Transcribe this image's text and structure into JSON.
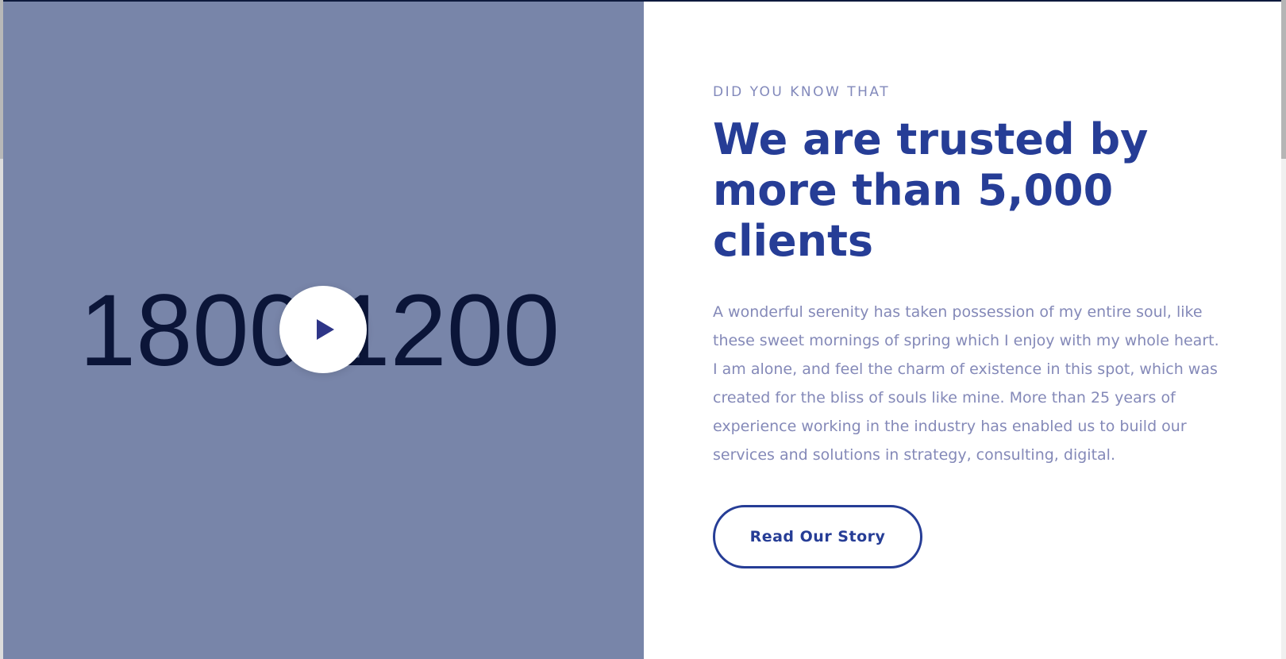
{
  "media": {
    "phone_number": "1800 1200",
    "play_icon": "play-icon"
  },
  "content": {
    "eyebrow": "DID YOU KNOW THAT",
    "headline": "We are trusted by more than 5,000 clients",
    "body": "A wonderful serenity has taken possession of my entire soul, like these sweet mornings of spring which I enjoy with my whole heart. I am alone, and feel the charm of existence in this spot, which was created for the bliss of souls like mine. More than 25 years of experience working in the industry has enabled us to build our services and solutions in strategy, consulting, digital.",
    "cta_label": "Read Our Story"
  },
  "colors": {
    "panel_bg": "#7885a9",
    "number_color": "#0b1538",
    "accent": "#263d96",
    "muted_text": "#8489b8",
    "eyebrow": "#8289bb",
    "play_icon": "#2e3587"
  }
}
